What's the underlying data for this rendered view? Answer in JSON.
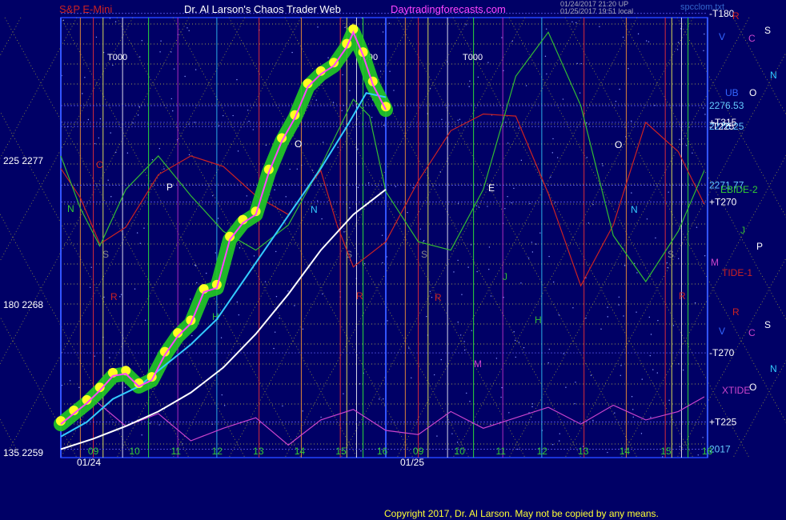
{
  "header": {
    "symbol": "S&P E-Mini",
    "site": "Dr. Al Larson's Chaos Trader Web",
    "url": "Daytradingforecasts.com",
    "stamp1": "01/24/2017 21:20 UP",
    "stamp2": "01/25/2017 19:51 local",
    "filename": "spcclom.txt"
  },
  "copyright": "Copyright 2017, Dr. Al Larson. May not be copied by any means.",
  "colors": {
    "background": "#000066",
    "price": "#ff44ff",
    "halo": "#22cc22",
    "dots": "#ffff22",
    "ma_fast": "#33ccff",
    "ma_slow": "#ffffff",
    "tide_red": "#cc2222",
    "tide_green": "#33bb33",
    "xtide": "#cc44cc"
  },
  "chart_data": {
    "type": "line",
    "title": "S&P E-Mini",
    "x_hours_label": [
      "09",
      "10",
      "11",
      "12",
      "13",
      "14",
      "15",
      "16",
      "09",
      "10",
      "11",
      "12",
      "13",
      "14",
      "15",
      "16"
    ],
    "date_labels": [
      "01/24",
      "01/25"
    ],
    "y_left_pairs": [
      [
        "225",
        "2277"
      ],
      [
        "180",
        "2268"
      ],
      [
        "135",
        "2259"
      ]
    ],
    "ylim": [
      2259,
      2280
    ],
    "events": [
      "T000",
      "T090",
      "T000"
    ],
    "right_levels": [
      {
        "label": "-T180",
        "value": 2280.2
      },
      {
        "label": "+T315",
        "value": 2275.0
      },
      {
        "label": "2276.53",
        "value": 2275.8
      },
      {
        "label": "2276.25",
        "value": 2274.8
      },
      {
        "label": "-T225",
        "value": 2274.8
      },
      {
        "label": "2271.77",
        "value": 2272.0
      },
      {
        "label": "+T270",
        "value": 2271.2
      },
      {
        "label": "-T270",
        "value": 2264.0
      },
      {
        "label": "+T225",
        "value": 2260.7
      },
      {
        "label": "2017",
        "value": 2259.4
      }
    ],
    "right_tags": [
      "R",
      "C",
      "S",
      "V",
      "N",
      "UB",
      "O",
      "EBIDE-2",
      "J",
      "P",
      "M",
      "TIDE-1",
      "R",
      "C",
      "S",
      "V",
      "N",
      "XTIDE",
      "O"
    ],
    "day1_markers": [
      "C",
      "P",
      "N",
      "S",
      "R",
      "H",
      "O",
      "N",
      "S",
      "R"
    ],
    "day2_markers": [
      "E",
      "S",
      "J",
      "H",
      "R",
      "M",
      "O",
      "N",
      "S",
      "R"
    ],
    "series": [
      {
        "name": "price",
        "x": [
          0,
          0.04,
          0.08,
          0.12,
          0.16,
          0.2,
          0.24,
          0.28,
          0.32,
          0.36,
          0.4,
          0.44,
          0.48,
          0.52,
          0.56,
          0.6,
          0.64,
          0.68,
          0.72,
          0.76,
          0.8,
          0.84,
          0.88,
          0.9,
          0.93,
          0.96,
          1.0
        ],
        "y": [
          2260.6,
          2261.1,
          2261.6,
          2262.2,
          2262.9,
          2263.0,
          2262.4,
          2262.7,
          2263.9,
          2264.8,
          2265.4,
          2266.9,
          2267.1,
          2269.4,
          2270.2,
          2270.6,
          2272.6,
          2274.1,
          2275.2,
          2276.7,
          2277.3,
          2277.7,
          2278.6,
          2279.3,
          2278.2,
          2276.8,
          2275.6
        ]
      },
      {
        "name": "fast_ma",
        "x": [
          0,
          0.08,
          0.16,
          0.24,
          0.32,
          0.4,
          0.48,
          0.56,
          0.64,
          0.72,
          0.8,
          0.88,
          0.94,
          1.0
        ],
        "y": [
          2260.0,
          2260.7,
          2261.8,
          2262.4,
          2263.4,
          2264.4,
          2265.6,
          2267.4,
          2269.2,
          2271.0,
          2272.8,
          2274.8,
          2276.4,
          2276.2
        ]
      },
      {
        "name": "slow_ma",
        "x": [
          0,
          0.1,
          0.2,
          0.3,
          0.4,
          0.5,
          0.6,
          0.7,
          0.8,
          0.9,
          1.0
        ],
        "y": [
          2259.4,
          2259.9,
          2260.5,
          2261.2,
          2262.1,
          2263.3,
          2264.9,
          2266.8,
          2268.9,
          2270.6,
          2271.8
        ]
      },
      {
        "name": "tide_red",
        "x": [
          0,
          0.06,
          0.12,
          0.2,
          0.3,
          0.4,
          0.5,
          0.6,
          0.7,
          0.8,
          0.85,
          0.9,
          1.0,
          1.1,
          1.2,
          1.3,
          1.4,
          1.5,
          1.6,
          1.7,
          1.8,
          1.9,
          1.98
        ],
        "y": [
          2272.8,
          2271.4,
          2269.2,
          2270.0,
          2272.5,
          2273.4,
          2272.9,
          2271.5,
          2270.6,
          2272.7,
          2270.1,
          2268.1,
          2269.3,
          2272.2,
          2274.6,
          2275.4,
          2275.3,
          2271.6,
          2267.2,
          2270.1,
          2275.0,
          2273.6,
          2271.1
        ]
      },
      {
        "name": "tide_green",
        "x": [
          0,
          0.06,
          0.12,
          0.2,
          0.3,
          0.4,
          0.5,
          0.6,
          0.7,
          0.8,
          0.9,
          0.95,
          1.0,
          1.1,
          1.2,
          1.3,
          1.4,
          1.5,
          1.6,
          1.7,
          1.8,
          1.9,
          1.98
        ],
        "y": [
          2273.4,
          2270.9,
          2269.1,
          2271.8,
          2273.4,
          2271.5,
          2269.8,
          2268.9,
          2270.1,
          2272.9,
          2276.1,
          2275.3,
          2271.7,
          2269.3,
          2268.9,
          2271.8,
          2277.2,
          2279.3,
          2275.8,
          2269.6,
          2267.4,
          2269.8,
          2272.7
        ]
      },
      {
        "name": "xtide",
        "x": [
          0,
          0.1,
          0.2,
          0.3,
          0.4,
          0.5,
          0.6,
          0.7,
          0.8,
          0.9,
          1.0,
          1.1,
          1.2,
          1.3,
          1.4,
          1.5,
          1.6,
          1.7,
          1.8,
          1.9,
          1.98
        ],
        "y": [
          2260.7,
          2261.8,
          2260.5,
          2261.1,
          2259.8,
          2260.4,
          2260.9,
          2259.6,
          2260.8,
          2261.3,
          2260.3,
          2260.1,
          2261.2,
          2260.4,
          2260.9,
          2261.4,
          2260.6,
          2261.5,
          2260.8,
          2261.2,
          2261.9
        ]
      }
    ]
  }
}
